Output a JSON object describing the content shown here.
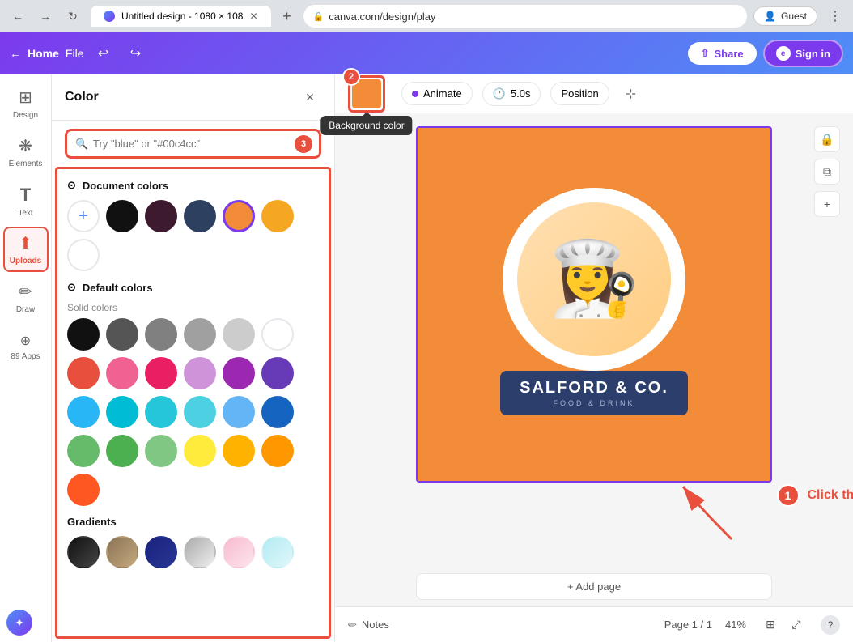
{
  "browser": {
    "tab_title": "Untitled design - 1080 × 108",
    "url": "canva.com/design/play",
    "guest_label": "Guest"
  },
  "toolbar": {
    "home_label": "Home",
    "file_label": "File",
    "share_label": "Share",
    "signin_label": "Sign in"
  },
  "sidebar": {
    "items": [
      {
        "id": "design",
        "label": "Design",
        "icon": "⊞"
      },
      {
        "id": "elements",
        "label": "Elements",
        "icon": "✦"
      },
      {
        "id": "text",
        "label": "Text",
        "icon": "T"
      },
      {
        "id": "uploads",
        "label": "Uploads",
        "icon": "⬆"
      },
      {
        "id": "draw",
        "label": "Draw",
        "icon": "✏"
      },
      {
        "id": "apps",
        "label": "89 Apps",
        "icon": "⊕"
      }
    ]
  },
  "color_panel": {
    "title": "Color",
    "close_icon": "×",
    "search_placeholder": "Try \"blue\" or \"#00c4cc\"",
    "document_colors_label": "Document colors",
    "default_colors_label": "Default colors",
    "solid_colors_label": "Solid colors",
    "gradients_label": "Gradients",
    "document_swatches": [
      {
        "color": "rainbow",
        "label": "rainbow"
      },
      {
        "color": "#111111",
        "label": "black"
      },
      {
        "color": "#3d1a2e",
        "label": "dark-maroon"
      },
      {
        "color": "#2d4060",
        "label": "dark-blue"
      },
      {
        "color": "#f28c38",
        "label": "orange-outlined",
        "outlined": true
      },
      {
        "color": "#f5a623",
        "label": "orange"
      },
      {
        "color": "#ffffff",
        "label": "white"
      }
    ],
    "solid_swatches": [
      "#111111",
      "#555555",
      "#888888",
      "#aaaaaa",
      "#cccccc",
      "#eeeeee",
      "#ffffff",
      "#e84f3d",
      "#f06292",
      "#f50057",
      "#ce93d8",
      "#9c27b0",
      "#673ab7",
      "#4fc3f7",
      "#29b6f6",
      "#00bcd4",
      "#4dd0e1",
      "#64b5f6",
      "#1565c0",
      "#66bb6a",
      "#4caf50",
      "#81c784",
      "#ffeb3b",
      "#ffb300",
      "#ff9800",
      "#ff5722"
    ],
    "gradient_swatches": [
      "#222222",
      "#8B7355",
      "#1a237e",
      "#cccccc",
      "#f8bbd0",
      "#b2ebf2"
    ]
  },
  "canvas_bar": {
    "animate_label": "Animate",
    "timing_label": "5.0s",
    "position_label": "Position",
    "bg_color_tooltip": "Background color"
  },
  "canvas": {
    "brand_name": "SALFORD & CO.",
    "brand_sub": "FOOD & DRINK",
    "chef_emoji": "👨‍🍳"
  },
  "annotations": {
    "step1_text": "Click the canva",
    "step1_badge": "1",
    "step2_badge": "2",
    "step3_badge": "3"
  },
  "bottom_bar": {
    "notes_label": "Notes",
    "notes_icon": "✏",
    "page_label": "Page 1 / 1",
    "zoom_label": "41%",
    "add_page_label": "+ Add page"
  }
}
